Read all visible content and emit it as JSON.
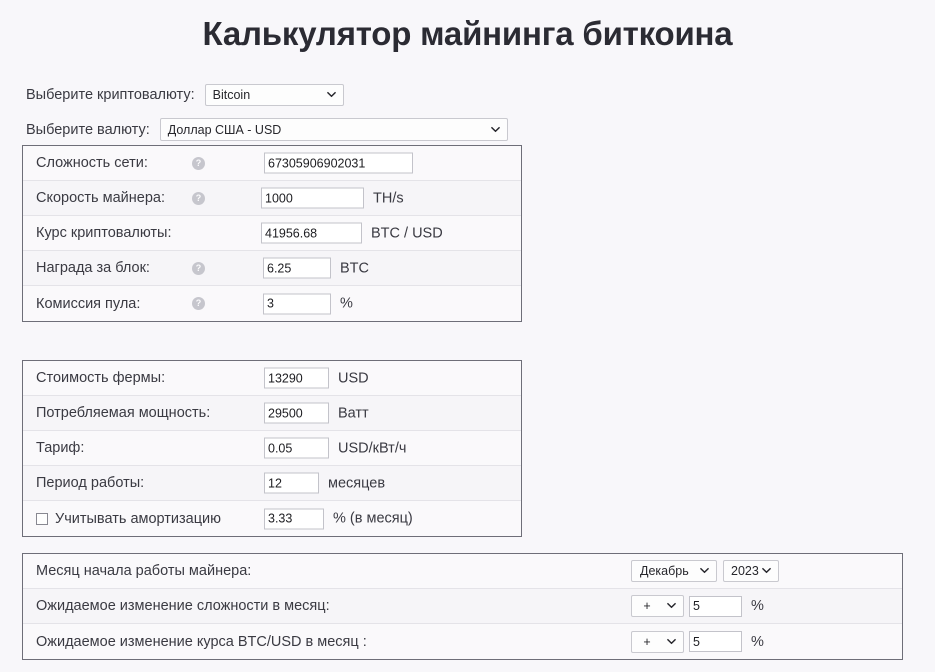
{
  "page": {
    "title": "Калькулятор майнинга биткоина",
    "background_color": "#f8f7fa",
    "title_color": "#2b2b33"
  },
  "selectors": {
    "crypto": {
      "label": "Выберите криптовалюту:",
      "value": "Bitcoin"
    },
    "currency": {
      "label": "Выберите валюту:",
      "value": "Доллар США - USD"
    }
  },
  "network_panel": {
    "rows": [
      {
        "label": "Сложность сети:",
        "help": "?",
        "value": "67305906902031",
        "unit": ""
      },
      {
        "label": "Скорость майнера:",
        "help": "?",
        "value": "1000",
        "unit": "TH/s"
      },
      {
        "label": "Курс криптовалюты:",
        "help": "",
        "value": "41956.68",
        "unit": "BTC / USD"
      },
      {
        "label": "Награда за блок:",
        "help": "?",
        "value": "6.25",
        "unit": "BTC"
      },
      {
        "label": "Комиссия пула:",
        "help": "?",
        "value": "3",
        "unit": "%"
      }
    ]
  },
  "farm_panel": {
    "rows": [
      {
        "label": "Стоимость фермы:",
        "value": "13290",
        "unit": "USD"
      },
      {
        "label": "Потребляемая мощность:",
        "value": "29500",
        "unit": "Ватт"
      },
      {
        "label": "Тариф:",
        "value": "0.05",
        "unit": "USD/кВт/ч"
      },
      {
        "label": "Период работы:",
        "value": "12",
        "unit": "месяцев"
      }
    ],
    "amortization": {
      "checkbox_label": "Учитывать амортизацию",
      "checked": false,
      "value": "3.33",
      "unit": "% (в месяц)"
    }
  },
  "forecast_panel": {
    "start_month": {
      "label": "Месяц начала работы майнера:",
      "month": "Декабрь",
      "year": "2023"
    },
    "difficulty_change": {
      "label": "Ожидаемое изменение сложности в месяц:",
      "sign": "+",
      "value": "5",
      "unit": "%"
    },
    "rate_change": {
      "label": "Ожидаемое изменение курса BTC/USD в месяц :",
      "sign": "+",
      "value": "5",
      "unit": "%"
    }
  }
}
